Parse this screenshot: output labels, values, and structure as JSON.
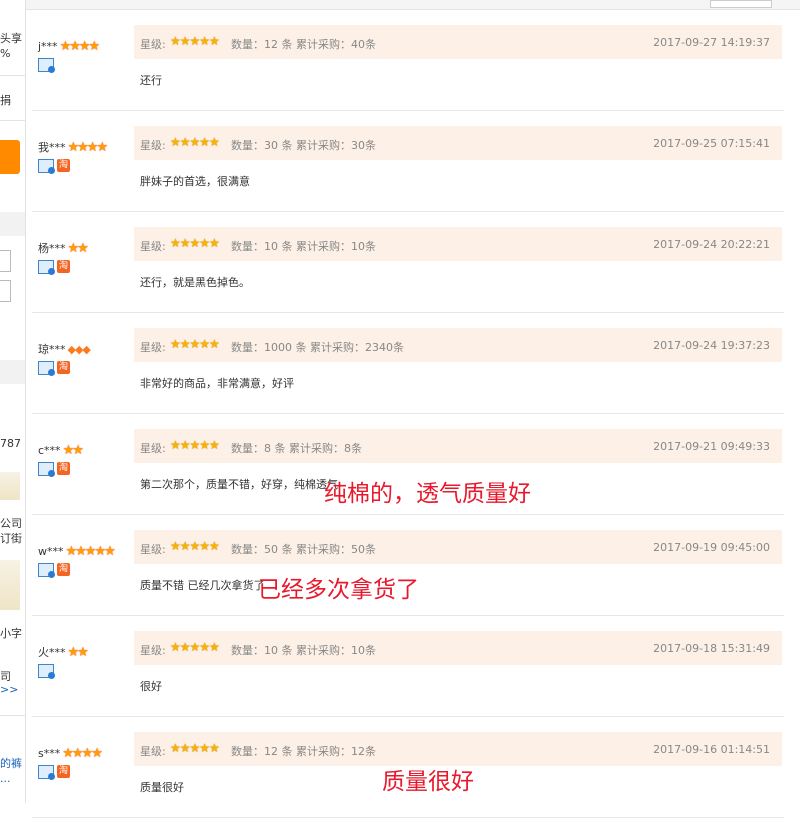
{
  "sidebar": {
    "fragments": [
      "头享",
      "%",
      "捐",
      "787",
      "公司",
      "订街",
      "小字",
      "司",
      ">>",
      "的裤",
      "..."
    ]
  },
  "reviews": [
    {
      "user": "j***",
      "badge": "★★★★",
      "badge_type": "red",
      "tao": false,
      "rating_label": "星级:",
      "stars": "★★★★★",
      "qty": "数量：12 条  累计采购：40条",
      "date": "2017-09-27 14:19:37",
      "content": "还行",
      "note": ""
    },
    {
      "user": "我***",
      "badge": "★★★★",
      "badge_type": "red",
      "tao": true,
      "rating_label": "星级:",
      "stars": "★★★★★",
      "qty": "数量：30 条  累计采购：30条",
      "date": "2017-09-25 07:15:41",
      "content": "胖妹子的首选，很满意",
      "note": ""
    },
    {
      "user": "杨***",
      "badge": "★★",
      "badge_type": "red",
      "tao": true,
      "rating_label": "星级:",
      "stars": "★★★★★",
      "qty": "数量：10 条  累计采购：10条",
      "date": "2017-09-24 20:22:21",
      "content": "还行，就是黑色掉色。",
      "note": ""
    },
    {
      "user": "琼***",
      "badge": "◆◆◆",
      "badge_type": "diamond",
      "tao": true,
      "rating_label": "星级:",
      "stars": "★★★★★",
      "qty": "数量：1000 条  累计采购：2340条",
      "date": "2017-09-24 19:37:23",
      "content": "非常好的商品，非常满意，好评",
      "note": ""
    },
    {
      "user": "c***",
      "badge": "★★",
      "badge_type": "red",
      "tao": true,
      "rating_label": "星级:",
      "stars": "★★★★★",
      "qty": "数量：8 条  累计采购：8条",
      "date": "2017-09-21 09:49:33",
      "content": "第二次那个，质量不错，好穿，纯棉透气",
      "note": "纯棉的，透气质量好"
    },
    {
      "user": "w***",
      "badge": "★★★★★",
      "badge_type": "red",
      "tao": true,
      "rating_label": "星级:",
      "stars": "★★★★★",
      "qty": "数量：50 条  累计采购：50条",
      "date": "2017-09-19 09:45:00",
      "content": "质量不错 已经几次拿货了",
      "note": "已经多次拿货了"
    },
    {
      "user": "火***",
      "badge": "★★",
      "badge_type": "red",
      "tao": false,
      "rating_label": "星级:",
      "stars": "★★★★★",
      "qty": "数量：10 条  累计采购：10条",
      "date": "2017-09-18 15:31:49",
      "content": "很好",
      "note": ""
    },
    {
      "user": "s***",
      "badge": "★★★★",
      "badge_type": "red",
      "tao": true,
      "rating_label": "星级:",
      "stars": "★★★★★",
      "qty": "数量：12 条  累计采购：12条",
      "date": "2017-09-16 01:14:51",
      "content": "质量很好",
      "note": "质量很好"
    }
  ],
  "icons": {
    "tao": "淘",
    "identity": "id-verified-icon"
  },
  "colors": {
    "info_bg": "#fdf0e6",
    "note_red": "#e8192c",
    "star": "#f4b400",
    "accent": "#ff8a00"
  }
}
